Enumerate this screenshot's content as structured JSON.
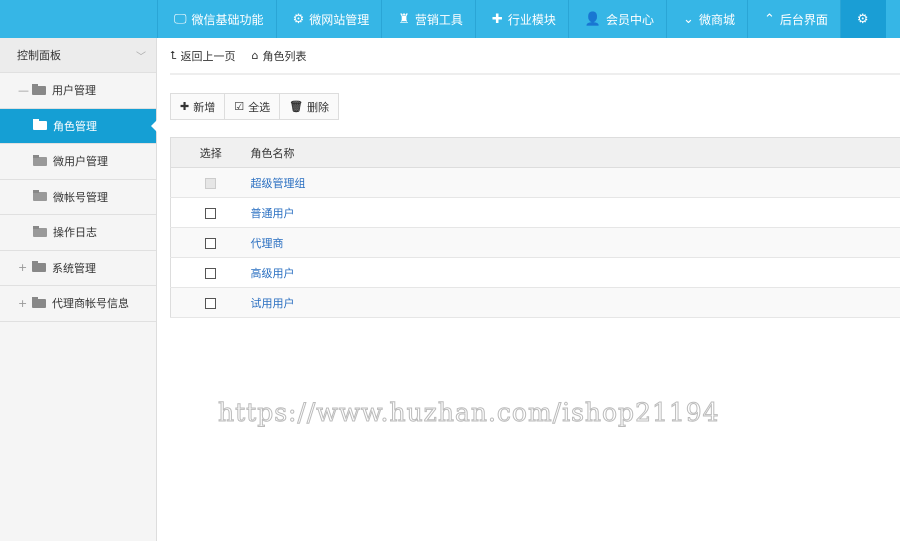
{
  "nav": [
    {
      "icon": "monitor-icon",
      "glyph": "🖵",
      "label": "微信基础功能"
    },
    {
      "icon": "gear-icon",
      "glyph": "⚙",
      "label": "微网站管理"
    },
    {
      "icon": "castle-icon",
      "glyph": "♜",
      "label": "营销工具"
    },
    {
      "icon": "puzzle-icon",
      "glyph": "✚",
      "label": "行业模块"
    },
    {
      "icon": "user-icon",
      "glyph": "👤",
      "label": "会员中心"
    },
    {
      "icon": "chevron-down-icon",
      "glyph": "⌄",
      "label": "微商城"
    },
    {
      "icon": "chevron-up-icon",
      "glyph": "⌃",
      "label": "后台界面"
    },
    {
      "icon": "gear-icon",
      "glyph": "⚙",
      "label": ""
    }
  ],
  "sidebar": {
    "title": "控制面板",
    "items": [
      {
        "label": "用户管理",
        "sign": "—"
      },
      {
        "label": "角色管理"
      },
      {
        "label": "微用户管理"
      },
      {
        "label": "微帐号管理"
      },
      {
        "label": "操作日志"
      },
      {
        "label": "系统管理",
        "sign": "+"
      },
      {
        "label": "代理商帐号信息",
        "sign": "+"
      }
    ]
  },
  "breadcrumb": {
    "back": "返回上一页",
    "current": "角色列表"
  },
  "toolbar": {
    "add": "新增",
    "select_all": "全选",
    "delete": "删除"
  },
  "table": {
    "headers": [
      "选择",
      "角色名称"
    ],
    "rows": [
      {
        "name": "超级管理组",
        "disabled": true
      },
      {
        "name": "普通用户"
      },
      {
        "name": "代理商"
      },
      {
        "name": "高级用户"
      },
      {
        "name": "试用用户"
      }
    ]
  },
  "watermark": "https://www.huzhan.com/ishop21194"
}
